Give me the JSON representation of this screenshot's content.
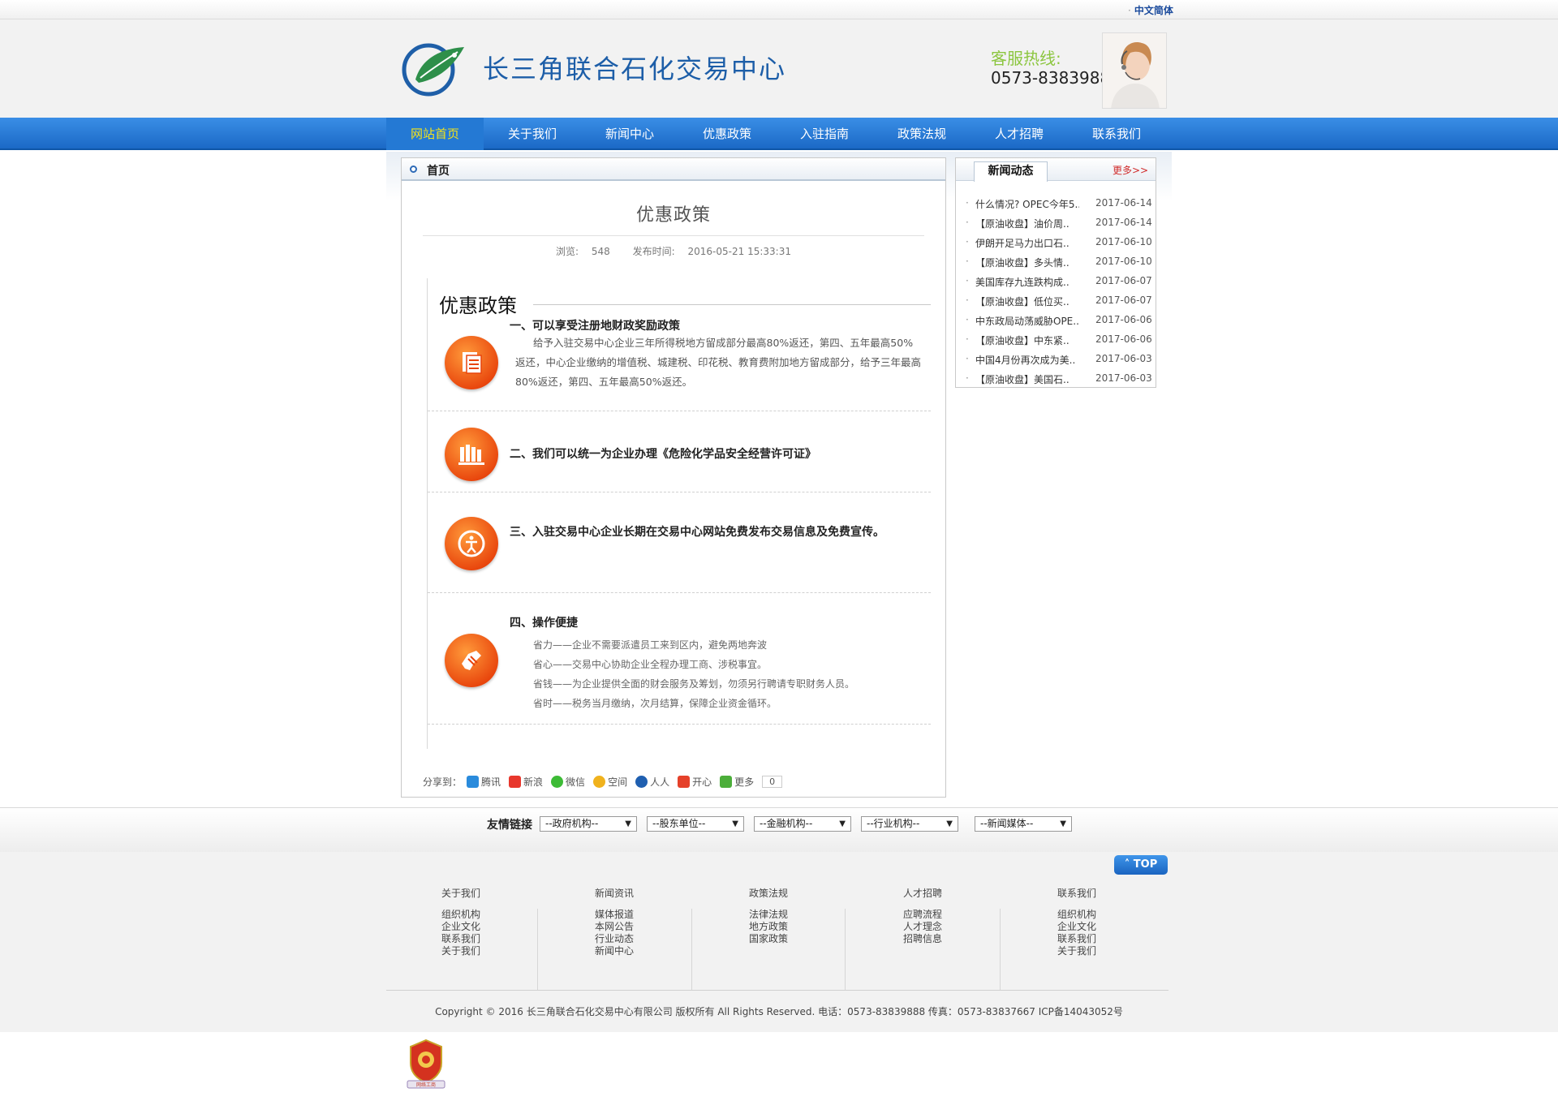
{
  "topbar": {
    "language": "中文简体"
  },
  "header": {
    "site_title": "长三角联合石化交易中心",
    "hotline_label": "客服热线:",
    "hotline_number": "0573-83839888"
  },
  "nav": {
    "items": [
      "网站首页",
      "关于我们",
      "新闻中心",
      "优惠政策",
      "入驻指南",
      "政策法规",
      "人才招聘",
      "联系我们"
    ],
    "active": "网站首页"
  },
  "breadcrumb": {
    "label": "首页"
  },
  "article": {
    "title": "优惠政策",
    "views_label": "浏览:",
    "views": "548",
    "published_label": "发布时间:",
    "published": "2016-05-21 15:33:31",
    "section_heading": "优惠政策",
    "items": [
      {
        "title": "一、可以享受注册地财政奖励政策",
        "body": "给予入驻交易中心企业三年所得税地方留成部分最高80%返还，第四、五年最高50%返还，中心企业缴纳的增值税、城建税、印花税、教育费附加地方留成部分，给予三年最高80%返还，第四、五年最高50%返还。",
        "icon": "document-icon"
      },
      {
        "title": "二、我们可以统一为企业办理《危险化学品安全经营许可证》",
        "icon": "books-icon"
      },
      {
        "title": "三、入驻交易中心企业长期在交易中心网站免费发布交易信息及免费宣传。",
        "icon": "person-icon"
      },
      {
        "title": "四、操作便捷",
        "lines": [
          "省力——企业不需要派遣员工来到区内，避免两地奔波",
          "省心——交易中心协助企业全程办理工商、涉税事宜。",
          "省钱——为企业提供全面的财会服务及筹划，勿须另行聘请专职财务人员。",
          "省时——税务当月缴纳，次月结算，保障企业资金循环。"
        ],
        "icon": "hand-icon"
      }
    ]
  },
  "share": {
    "label": "分享到：",
    "targets": [
      {
        "name": "腾讯",
        "color": "#2a8bdc"
      },
      {
        "name": "新浪",
        "color": "#e8372c"
      },
      {
        "name": "微信",
        "color": "#3dbb36"
      },
      {
        "name": "空间",
        "color": "#f0b21d"
      },
      {
        "name": "人人",
        "color": "#1f5fb0"
      },
      {
        "name": "开心",
        "color": "#e5412a"
      },
      {
        "name": "更多",
        "color": "#4cae3a"
      }
    ],
    "count": "0"
  },
  "sidebar": {
    "tab_label": "新闻动态",
    "more_label": "更多>>",
    "news": [
      {
        "title": "什么情况? OPEC今年5..",
        "date": "2017-06-14"
      },
      {
        "title": "【原油收盘】油价周..",
        "date": "2017-06-14"
      },
      {
        "title": "伊朗开足马力出口石..",
        "date": "2017-06-10"
      },
      {
        "title": "【原油收盘】多头情..",
        "date": "2017-06-10"
      },
      {
        "title": "美国库存九连跌构成..",
        "date": "2017-06-07"
      },
      {
        "title": "【原油收盘】低位买..",
        "date": "2017-06-07"
      },
      {
        "title": "中东政局动荡威胁OPE..",
        "date": "2017-06-06"
      },
      {
        "title": "【原油收盘】中东紧..",
        "date": "2017-06-06"
      },
      {
        "title": "中国4月份再次成为美..",
        "date": "2017-06-03"
      },
      {
        "title": "【原油收盘】美国石..",
        "date": "2017-06-03"
      }
    ]
  },
  "links": {
    "label": "友情链接",
    "selects": [
      "--政府机构--",
      "--股东单位--",
      "--金融机构--",
      "--行业机构--",
      "--新闻媒体--"
    ]
  },
  "footer": {
    "top_label": "TOP",
    "columns": [
      {
        "head": "关于我们",
        "links": [
          "组织机构",
          "企业文化",
          "联系我们",
          "关于我们"
        ]
      },
      {
        "head": "新闻资讯",
        "links": [
          "媒体报道",
          "本网公告",
          "行业动态",
          "新闻中心"
        ]
      },
      {
        "head": "政策法规",
        "links": [
          "法律法规",
          "地方政策",
          "国家政策"
        ]
      },
      {
        "head": "人才招聘",
        "links": [
          "应聘流程",
          "人才理念",
          "招聘信息"
        ]
      },
      {
        "head": "联系我们",
        "links": [
          "组织机构",
          "企业文化",
          "联系我们",
          "关于我们"
        ]
      }
    ],
    "copyright": "Copyright © 2016 长三角联合石化交易中心有限公司 版权所有 All Rights Reserved. 电话：0573-83839888 传真：0573-83837667 ICP备14043052号",
    "badge_text": "网络工商"
  },
  "colors": {
    "nav_bg": "#1b69c6",
    "nav_active_text": "#f4e21a",
    "brand_blue": "#1d5ea8",
    "hotline_green": "#8cc63f",
    "icon_orange": "#e8440c",
    "more_red": "#d02a2a"
  }
}
